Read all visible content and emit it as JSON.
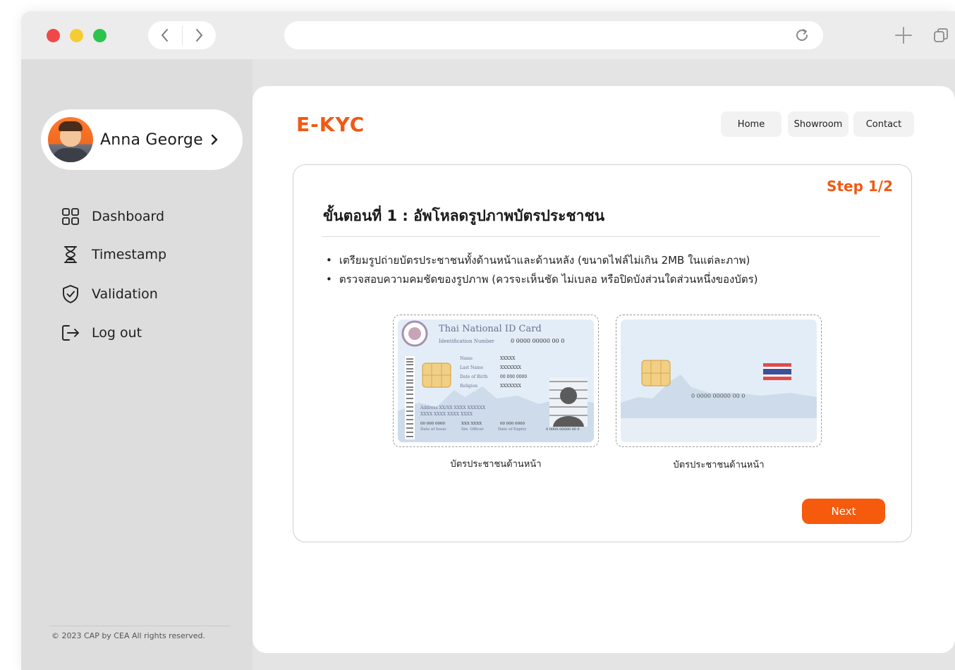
{
  "browser": {
    "back_icon": "chevron-left-icon",
    "forward_icon": "chevron-right-icon",
    "reload_icon": "reload-icon",
    "new_tab_icon": "plus-icon",
    "tabs_icon": "tabs-overview-icon"
  },
  "sidebar": {
    "profile_name": "Anna George",
    "items": [
      {
        "label": "Dashboard",
        "icon": "dashboard-grid-icon"
      },
      {
        "label": "Timestamp",
        "icon": "hourglass-icon"
      },
      {
        "label": "Validation",
        "icon": "shield-check-icon"
      },
      {
        "label": "Log out",
        "icon": "logout-icon"
      }
    ],
    "footer": "© 2023  CAP by CEA All rights reserved."
  },
  "header": {
    "brand": "E-KYC",
    "nav": [
      "Home",
      "Showroom",
      "Contact"
    ]
  },
  "card": {
    "step": "Step 1/2",
    "title": "ขั้นตอนที่ 1 : อัพโหลดรูปภาพบัตรประชาชน",
    "bullets": [
      "เตรียมรูปถ่ายบัตรประชาชนทั้งด้านหน้าและด้านหลัง (ขนาดไฟล์ไม่เกิน 2MB ในแต่ละภาพ)",
      "ตรวจสอบความคมชัดของรูปภาพ (ควรจะเห็นชัด ไม่เบลอ หรือปิดบังส่วนใดส่วนหนึ่งของบัตร)"
    ],
    "front_card": {
      "title": "Thai National ID Card",
      "id_label": "Identification Number",
      "id_value": "0 0000 00000 00 0",
      "fields": [
        {
          "label": "Name",
          "value": "XXXXX"
        },
        {
          "label": "Last Name",
          "value": "XXXXXXX"
        },
        {
          "label": "Date of Birth",
          "value": "00 000 0000"
        },
        {
          "label": "Religion",
          "value": "XXXXXXX"
        }
      ],
      "address_1": "Address XX/XX XXXX XXXXXX",
      "address_2": "XXXX XXXX XXXX XXXX",
      "issue_value": "00 000 0000",
      "issue_label": "Date of Issue",
      "officer_value": "XXX XXXX",
      "officer_label": "Sin. Officer",
      "expiry_value": "00 000 0000",
      "expiry_label": "Date of Expiry",
      "serial": "0 0000 00000 00 0"
    },
    "back_card": {
      "number": "0 0000 00000 00 0"
    },
    "front_caption": "บัตรประชาชนด้านหน้า",
    "back_caption": "บัตรประชาชนด้านหน้า",
    "next_label": "Next"
  },
  "colors": {
    "accent": "#f05a14",
    "button": "#f55a0d",
    "sidebar_bg": "#dddddd"
  }
}
